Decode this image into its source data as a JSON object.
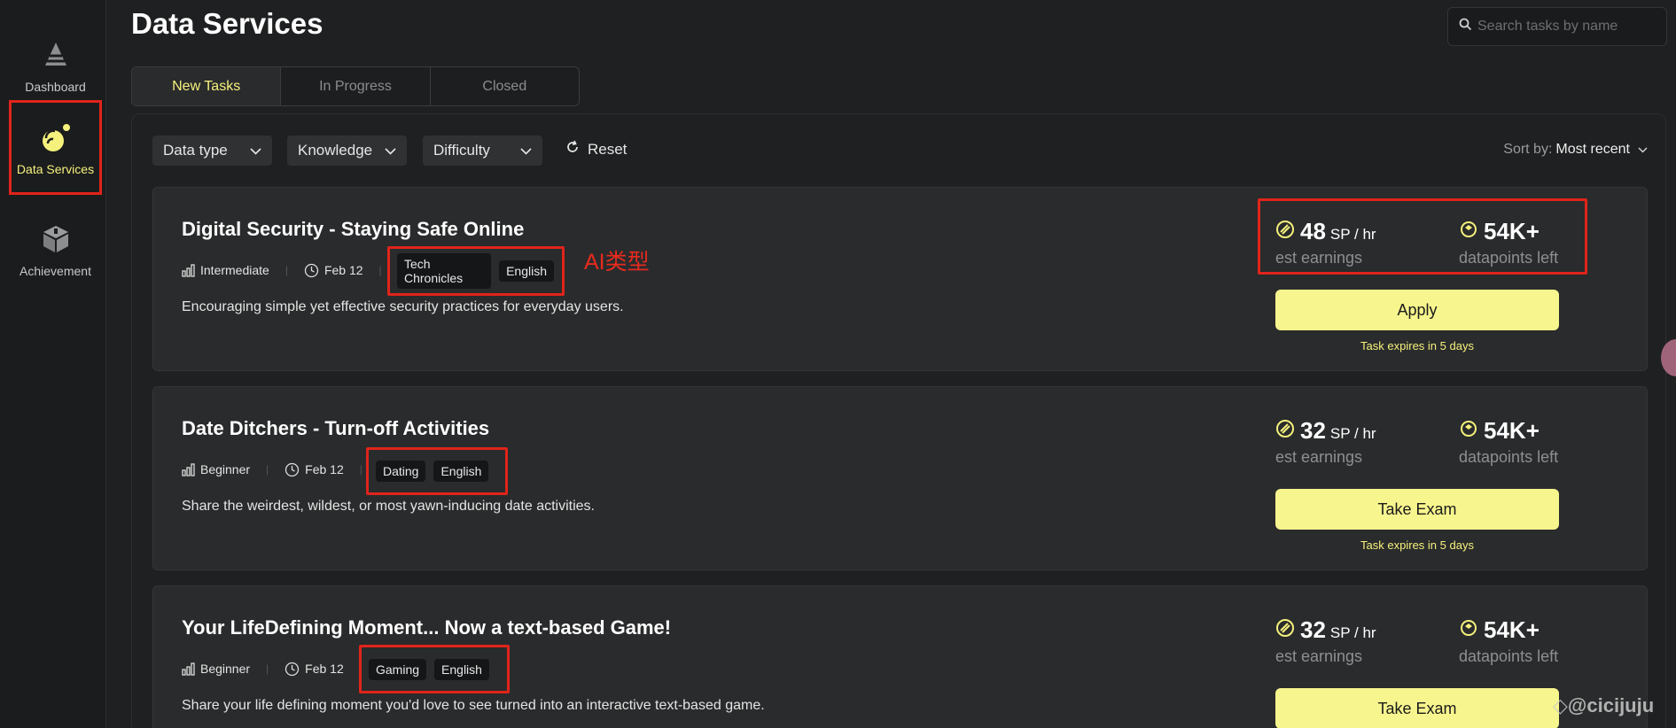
{
  "sidebar": {
    "items": [
      {
        "label": "Dashboard",
        "icon": "pyramid-icon"
      },
      {
        "label": "Data Services",
        "icon": "satellite-icon",
        "active": true
      },
      {
        "label": "Achievement",
        "icon": "cube-icon"
      }
    ]
  },
  "header": {
    "title": "Data Services",
    "search_placeholder": "Search tasks by name"
  },
  "tabs": [
    {
      "label": "New Tasks",
      "active": true
    },
    {
      "label": "In Progress"
    },
    {
      "label": "Closed"
    }
  ],
  "filters": {
    "data_type": "Data type",
    "knowledge": "Knowledge",
    "difficulty": "Difficulty",
    "reset": "Reset",
    "sort_label": "Sort by:",
    "sort_value": "Most recent"
  },
  "annotation": "AI类型",
  "tasks": [
    {
      "title": "Digital Security - Staying Safe Online",
      "level": "Intermediate",
      "date": "Feb 12",
      "tags": [
        "Tech Chronicles",
        "English"
      ],
      "description": "Encouraging simple yet effective security practices for everyday users.",
      "rate": "48",
      "rate_unit": "SP / hr",
      "rate_label": "est earnings",
      "datapoints": "54K+",
      "datapoints_label": "datapoints left",
      "action": "Apply",
      "expires": "Task expires in 5 days"
    },
    {
      "title": "Date Ditchers - Turn-off Activities",
      "level": "Beginner",
      "date": "Feb 12",
      "tags": [
        "Dating",
        "English"
      ],
      "description": "Share the weirdest, wildest, or most yawn-inducing date activities.",
      "rate": "32",
      "rate_unit": "SP / hr",
      "rate_label": "est earnings",
      "datapoints": "54K+",
      "datapoints_label": "datapoints left",
      "action": "Take Exam",
      "expires": "Task expires in 5 days"
    },
    {
      "title": "Your LifeDefining Moment... Now a text-based Game!",
      "level": "Beginner",
      "date": "Feb 12",
      "tags": [
        "Gaming",
        "English"
      ],
      "description": "Share your life defining moment you'd love to see turned into an interactive text-based game.",
      "rate": "32",
      "rate_unit": "SP / hr",
      "rate_label": "est earnings",
      "datapoints": "54K+",
      "datapoints_label": "datapoints left",
      "action": "Take Exam",
      "expires": ""
    }
  ],
  "watermark": "◇@cicijuju",
  "colors": {
    "accent": "#f5f17c",
    "button": "#f7f58d",
    "highlight_box": "#e0241b"
  }
}
